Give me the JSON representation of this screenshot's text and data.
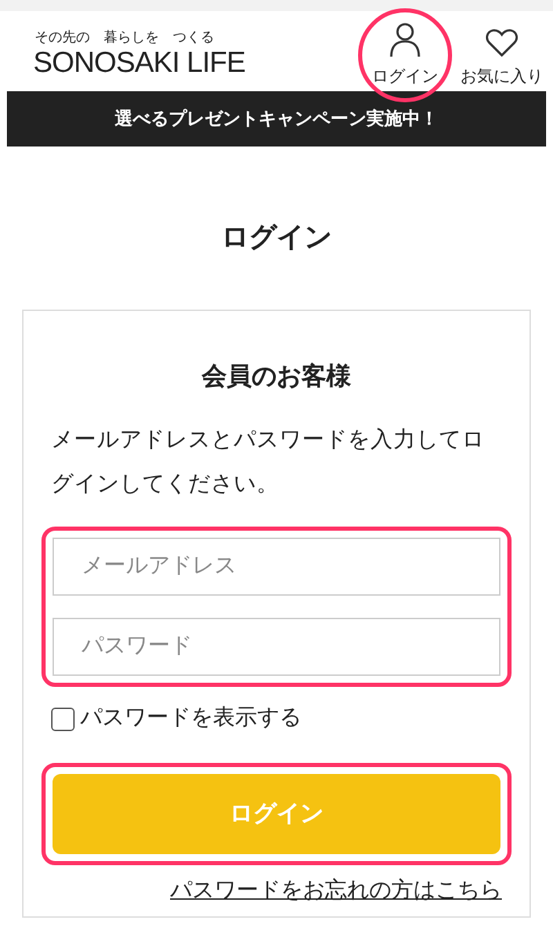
{
  "header": {
    "tagline": "その先の　暮らしを　つくる",
    "logo": "SONOSAKI LIFE",
    "nav": [
      {
        "kind": "user",
        "label": "ログイン",
        "highlighted": true
      },
      {
        "kind": "heart",
        "label": "お気に入り",
        "highlighted": false
      }
    ]
  },
  "banner": "選べるプレゼントキャンペーン実施中！",
  "page_title": "ログイン",
  "card": {
    "title": "会員のお客様",
    "description": "メールアドレスとパスワードを入力してログインしてください。",
    "fields": [
      {
        "placeholder": "メールアドレス"
      },
      {
        "placeholder": "パスワード"
      }
    ],
    "fields_highlighted": true,
    "show_password": {
      "label": "パスワードを表示する",
      "checked": false
    },
    "submit": {
      "label": "ログイン",
      "highlighted": true
    },
    "forgot_link": "パスワードをお忘れの方はこちら"
  }
}
